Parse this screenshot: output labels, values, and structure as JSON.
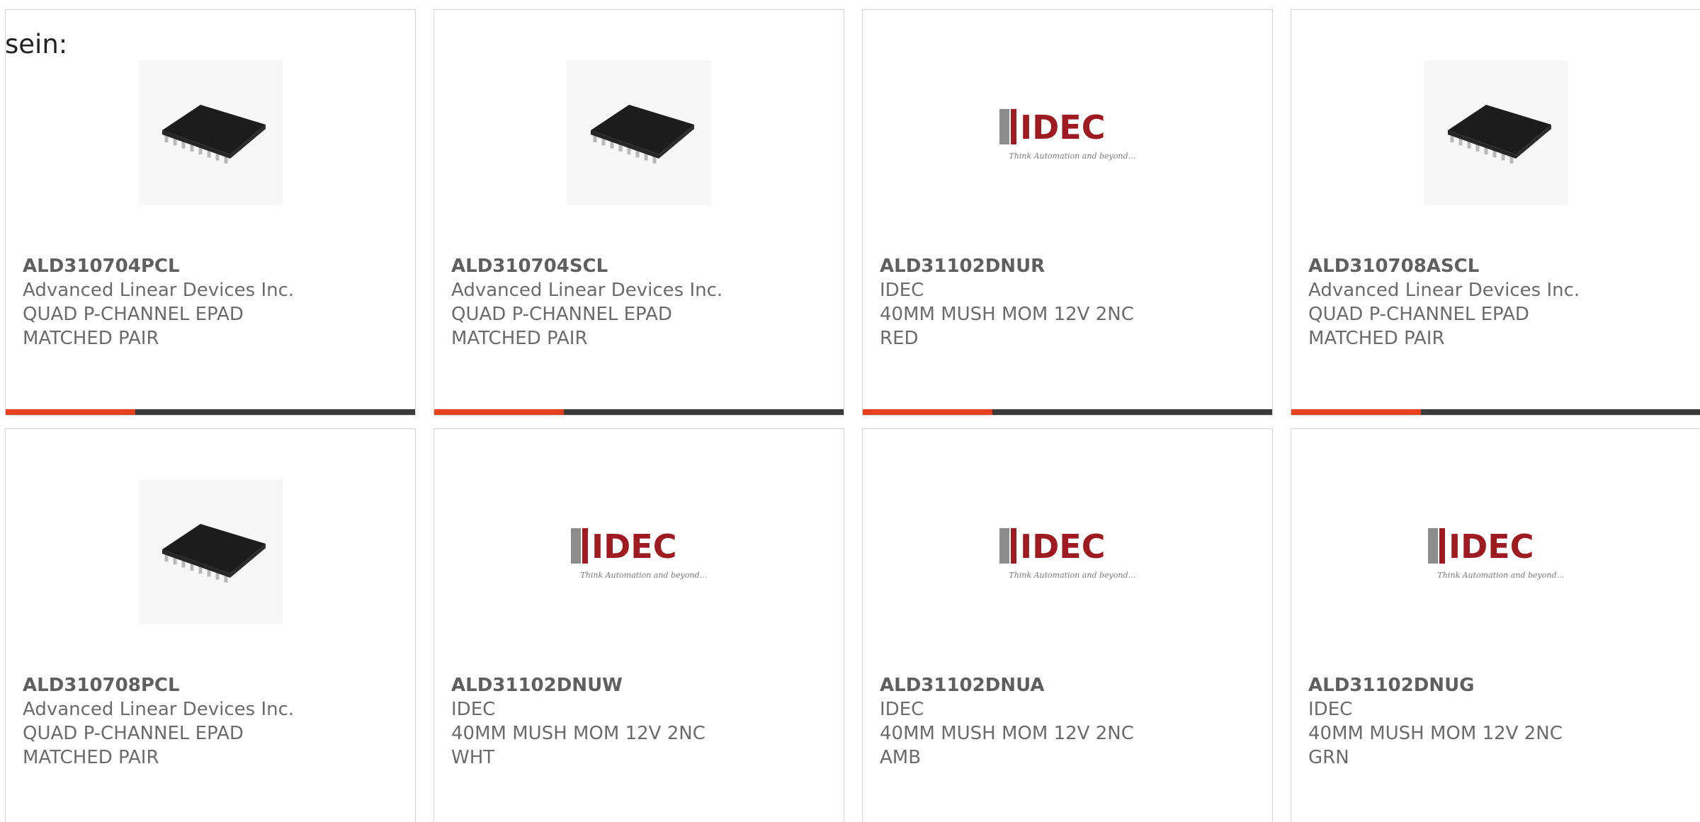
{
  "top_text": "sein:",
  "products": [
    {
      "part": "ALD310704PCL",
      "maker": "Advanced Linear Devices Inc.",
      "desc": "QUAD P-CHANNEL EPAD MATCHED PAIR",
      "image": "chip-icon"
    },
    {
      "part": "ALD310704SCL",
      "maker": "Advanced Linear Devices Inc.",
      "desc": "QUAD P-CHANNEL EPAD MATCHED PAIR",
      "image": "chip-icon"
    },
    {
      "part": "ALD31102DNUR",
      "maker": "IDEC",
      "desc": "40MM MUSH MOM 12V 2NC RED",
      "image": "idec-logo"
    },
    {
      "part": "ALD310708ASCL",
      "maker": "Advanced Linear Devices Inc.",
      "desc": "QUAD P-CHANNEL EPAD MATCHED PAIR",
      "image": "chip-icon"
    },
    {
      "part": "ALD310708PCL",
      "maker": "Advanced Linear Devices Inc.",
      "desc": "QUAD P-CHANNEL EPAD MATCHED PAIR",
      "image": "chip-icon"
    },
    {
      "part": "ALD31102DNUW",
      "maker": "IDEC",
      "desc": "40MM MUSH MOM 12V 2NC WHT",
      "image": "idec-logo"
    },
    {
      "part": "ALD31102DNUA",
      "maker": "IDEC",
      "desc": "40MM MUSH MOM 12V 2NC AMB",
      "image": "idec-logo"
    },
    {
      "part": "ALD31102DNUG",
      "maker": "IDEC",
      "desc": "40MM MUSH MOM 12V 2NC GRN",
      "image": "idec-logo"
    }
  ],
  "idec_logo": {
    "wordmark": "IDEC",
    "tagline": "Think Automation and beyond..."
  },
  "colors": {
    "accent": "#e8401c",
    "bar_dark": "#3b3b3b",
    "logo_red": "#9e1b22",
    "logo_gray": "#8c8c8c",
    "text": "#6b6b6b"
  }
}
